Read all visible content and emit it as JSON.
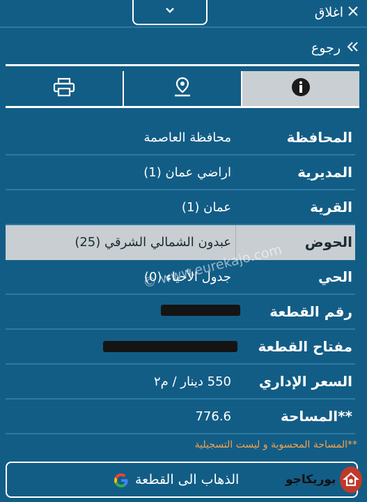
{
  "header": {
    "close_label": "اغلاق",
    "back_label": "رجوع"
  },
  "tabs": [
    {
      "icon": "printer-icon",
      "active": false
    },
    {
      "icon": "map-pin-icon",
      "active": false
    },
    {
      "icon": "info-icon",
      "active": true
    }
  ],
  "details": {
    "governorate": {
      "label": "المحافظة",
      "value": "محافظة العاصمة"
    },
    "directorate": {
      "label": "المديرية",
      "value": "اراضي عمان (1)"
    },
    "village": {
      "label": "القرية",
      "value": "عمان (1)"
    },
    "basin": {
      "label": "الحوض",
      "value": "عبدون الشمالي الشرقي (25)"
    },
    "neighborhood": {
      "label": "الحي",
      "value": "جدول الأحياء (0)"
    },
    "plot_number": {
      "label": "رقم القطعة",
      "value": ""
    },
    "plot_key": {
      "label": "مفتاح القطعة",
      "value": ""
    },
    "admin_price": {
      "label": "السعر الإداري",
      "value": "550 دينار / م٢"
    },
    "area": {
      "label": "المساحة**",
      "value": "776.6"
    }
  },
  "watermark": "© www.eurekajo.com",
  "note": "**المساحة المحسوبة و ليست التسجيلية",
  "goto_button": {
    "label": "الذهاب الى القطعة"
  },
  "logo": {
    "text": "بوريكاجو"
  },
  "colors": {
    "background": "#125d86",
    "highlight": "#c8ced2",
    "note": "#f5a24b"
  }
}
